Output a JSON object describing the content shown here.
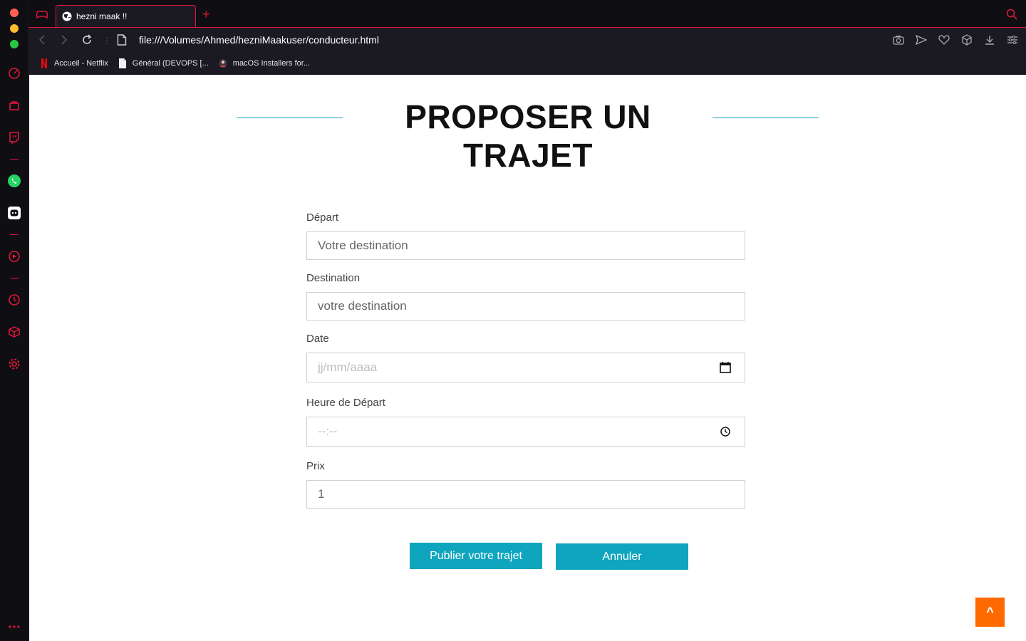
{
  "browser": {
    "tab_title": "hezni maak !!",
    "url": "file:///Volumes/Ahmed/hezniMaakuser/conducteur.html",
    "bookmarks": [
      {
        "label": "Accueil - Netflix"
      },
      {
        "label": "Général (DEVOPS [..."
      },
      {
        "label": "macOS Installers for..."
      }
    ],
    "accent_color": "#e0173b"
  },
  "page": {
    "title": "PROPOSER UN TRAJET",
    "accent_color": "#17a2b8"
  },
  "form": {
    "depart": {
      "label": "Départ",
      "placeholder": "Votre destination"
    },
    "destination": {
      "label": "Destination",
      "placeholder": "votre destination"
    },
    "date": {
      "label": "Date",
      "placeholder": "jj/mm/aaaa"
    },
    "heure": {
      "label": "Heure de Départ",
      "placeholder": "--:--"
    },
    "prix": {
      "label": "Prix",
      "value": "1"
    }
  },
  "actions": {
    "publish_label": "Publier votre trajet",
    "cancel_label": "Annuler",
    "scroll_top_label": "^"
  }
}
